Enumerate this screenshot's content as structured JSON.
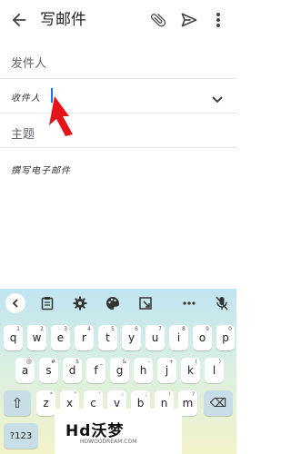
{
  "app_bar": {
    "title": "写邮件",
    "back_icon": "arrow-left-icon",
    "attach_icon": "paperclip-icon",
    "send_icon": "send-icon",
    "more_icon": "more-vert-icon"
  },
  "form": {
    "sender_label": "发件人",
    "recipient_label": "收件人",
    "subject_label": "主题",
    "body_placeholder": "撰写电子邮件"
  },
  "keyboard": {
    "rows": [
      {
        "keys": [
          "q",
          "w",
          "e",
          "r",
          "t",
          "y",
          "u",
          "i",
          "o",
          "p"
        ],
        "hints": [
          "1",
          "2",
          "3",
          "4",
          "5",
          "6",
          "7",
          "8",
          "9",
          "0"
        ]
      },
      {
        "keys": [
          "a",
          "s",
          "d",
          "f",
          "g",
          "h",
          "j",
          "k",
          "l"
        ],
        "hints": [
          "@",
          "#",
          "$",
          "_",
          "&",
          "-",
          "+",
          "(",
          ")"
        ]
      },
      {
        "keys": [
          "z",
          "x",
          "c",
          "v",
          "b",
          "n",
          "m"
        ],
        "hints": [
          "*",
          "\"",
          "'",
          ":",
          ";",
          "!",
          "?"
        ]
      }
    ],
    "shift_label": "⇧",
    "backspace_label": "⌫",
    "symbols_label": "?123"
  },
  "watermark": {
    "brand": "Hd沃梦",
    "sub": "HDWOODREAM.COM"
  },
  "colors": {
    "caret": "#1a73e8",
    "arrow": "#e4141b",
    "keyboard_top": "#bfe4f1",
    "keyboard_bottom": "#f2f3c9"
  }
}
